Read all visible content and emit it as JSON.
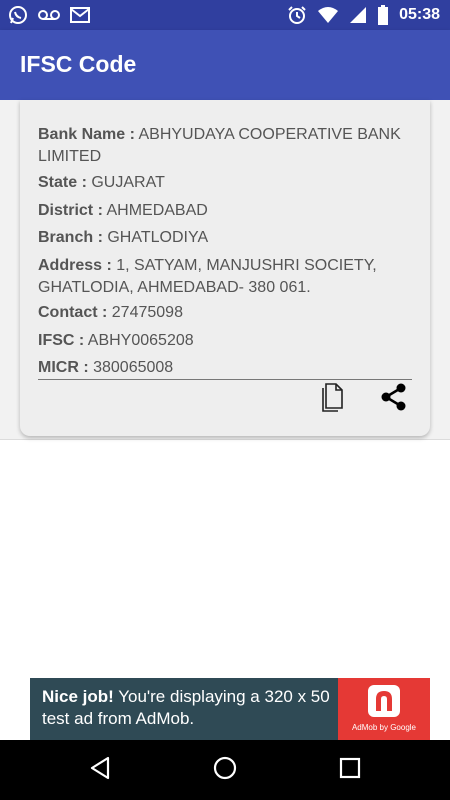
{
  "status_bar": {
    "time": "05:38",
    "left_icons": [
      "whatsapp-icon",
      "voicemail-icon",
      "gmail-icon"
    ],
    "right_icons": [
      "alarm-icon",
      "wifi-icon",
      "signal-icon",
      "battery-icon"
    ]
  },
  "app": {
    "title": "IFSC Code",
    "bar_color": "#3f51b5",
    "status_color": "#303f9f"
  },
  "details": {
    "bank_label": "Bank Name :",
    "bank_value": "ABHYUDAYA COOPERATIVE BANK LIMITED",
    "state_label": "State  :",
    "state_value": "GUJARAT",
    "district_label": "District :",
    "district_value": "AHMEDABAD",
    "branch_label": "Branch  :",
    "branch_value": "GHATLODIYA",
    "address_label": "Address :",
    "address_value": "1, SATYAM, MANJUSHRI SOCIETY, GHATLODIA, AHMEDABAD- 380 061.",
    "contact_label": "Contact :",
    "contact_value": "27475098",
    "ifsc_label": "IFSC :",
    "ifsc_value": "ABHY0065208",
    "micr_label": "MICR :",
    "micr_value": "380065008"
  },
  "actions": {
    "copy_icon": "copy-icon",
    "share_icon": "share-icon"
  },
  "ad": {
    "headline": "Nice job!",
    "body": " You're displaying a 320 x 50 test ad from AdMob.",
    "caption": "AdMob by Google",
    "logo_color": "#e53935"
  },
  "nav": {
    "icons": [
      "back-icon",
      "home-icon",
      "recents-icon"
    ]
  }
}
